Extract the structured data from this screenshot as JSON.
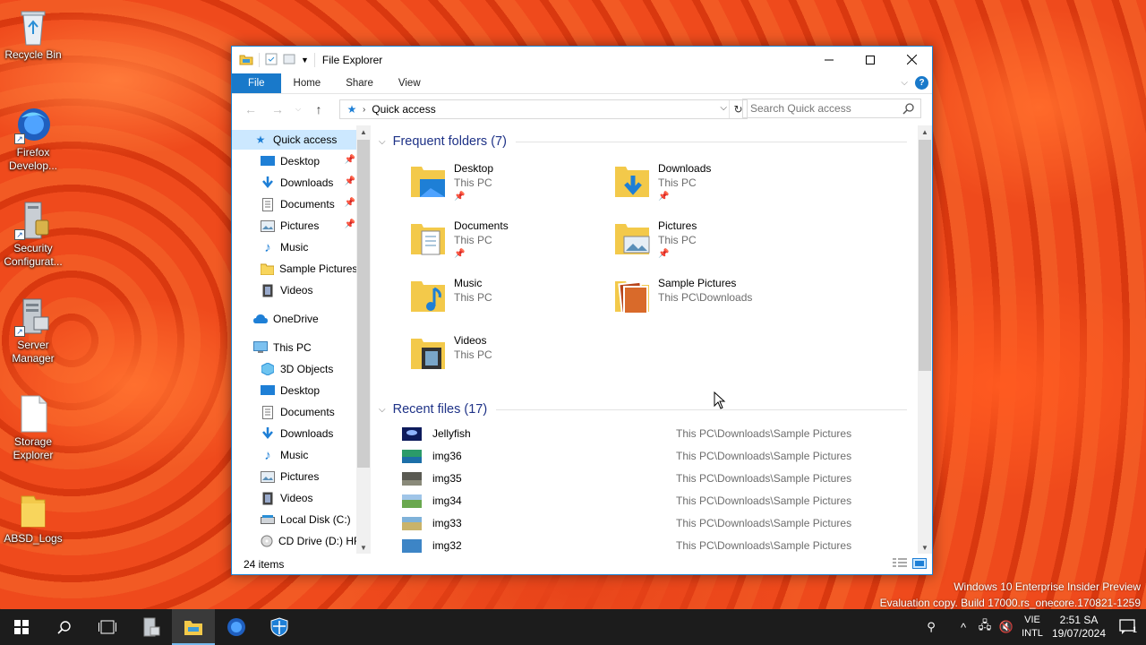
{
  "desktop": {
    "icons": [
      {
        "label": "Recycle Bin",
        "icon": "recycle-bin-icon"
      },
      {
        "label": "Firefox Develop...",
        "icon": "firefox-developer-icon"
      },
      {
        "label": "Security Configurat...",
        "icon": "security-config-icon"
      },
      {
        "label": "Server Manager",
        "icon": "server-manager-icon"
      },
      {
        "label": "Storage Explorer",
        "icon": "storage-explorer-icon"
      },
      {
        "label": "ABSD_Logs",
        "icon": "folder-icon"
      }
    ]
  },
  "window": {
    "title": "File Explorer",
    "tabs": {
      "file": "File",
      "home": "Home",
      "share": "Share",
      "view": "View"
    },
    "address": "Quick access",
    "search_placeholder": "Search Quick access",
    "status": "24 items"
  },
  "nav": {
    "quick_access": "Quick access",
    "quick_items": [
      "Desktop",
      "Downloads",
      "Documents",
      "Pictures",
      "Music",
      "Sample Pictures",
      "Videos"
    ],
    "onedrive": "OneDrive",
    "this_pc": "This PC",
    "pc_items": [
      "3D Objects",
      "Desktop",
      "Documents",
      "Downloads",
      "Music",
      "Pictures",
      "Videos",
      "Local Disk (C:)",
      "CD Drive (D:) HR"
    ]
  },
  "frequent": {
    "heading": "Frequent folders (7)",
    "folders": [
      {
        "name": "Desktop",
        "location": "This PC",
        "pinned": true
      },
      {
        "name": "Downloads",
        "location": "This PC",
        "pinned": true
      },
      {
        "name": "Documents",
        "location": "This PC",
        "pinned": true
      },
      {
        "name": "Pictures",
        "location": "This PC",
        "pinned": true
      },
      {
        "name": "Music",
        "location": "This PC",
        "pinned": false
      },
      {
        "name": "Sample Pictures",
        "location": "This PC\\Downloads",
        "pinned": false
      },
      {
        "name": "Videos",
        "location": "This PC",
        "pinned": false
      }
    ]
  },
  "recent": {
    "heading": "Recent files (17)",
    "files": [
      {
        "name": "Jellyfish",
        "path": "This PC\\Downloads\\Sample Pictures"
      },
      {
        "name": "img36",
        "path": "This PC\\Downloads\\Sample Pictures"
      },
      {
        "name": "img35",
        "path": "This PC\\Downloads\\Sample Pictures"
      },
      {
        "name": "img34",
        "path": "This PC\\Downloads\\Sample Pictures"
      },
      {
        "name": "img33",
        "path": "This PC\\Downloads\\Sample Pictures"
      },
      {
        "name": "img32",
        "path": "This PC\\Downloads\\Sample Pictures"
      }
    ]
  },
  "watermark": {
    "line1": "Windows 10 Enterprise Insider Preview",
    "line2": "Evaluation copy. Build 17000.rs_onecore.170821-1259"
  },
  "taskbar": {
    "lang_top": "VIE",
    "lang_bottom": "INTL",
    "time": "2:51 SA",
    "date": "19/07/2024",
    "notification_count": "1"
  },
  "colors": {
    "accent": "#1979ca",
    "selected": "#cce8ff",
    "group_heading": "#1e3287",
    "taskbar": "#1c1c1c"
  }
}
